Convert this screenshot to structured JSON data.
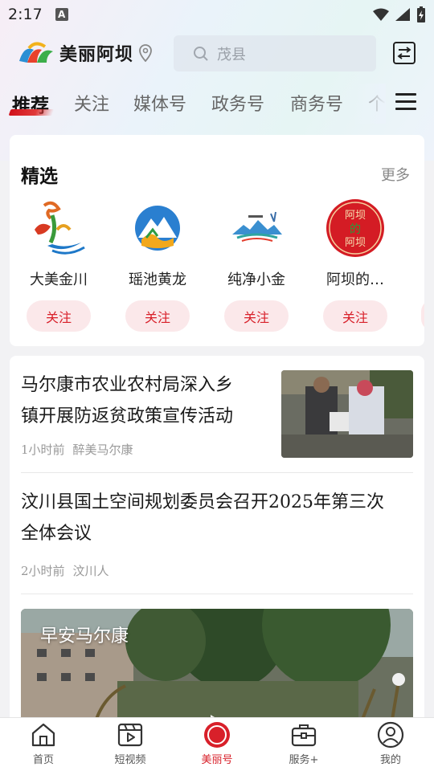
{
  "status_bar": {
    "time": "2:17",
    "notification_icon": "A"
  },
  "header": {
    "logo_text": "美丽阿坝",
    "search_placeholder": "茂县",
    "icons": [
      "logo-icon",
      "location-pin-icon",
      "search-icon",
      "menu-square-icon"
    ]
  },
  "tabs": [
    {
      "label": "推荐",
      "active": true
    },
    {
      "label": "关注"
    },
    {
      "label": "媒体号"
    },
    {
      "label": "政务号"
    },
    {
      "label": "商务号"
    },
    {
      "label": "个人"
    }
  ],
  "featured": {
    "title": "精选",
    "more_label": "更多",
    "accounts": [
      {
        "name": "大美金川",
        "follow_label": "关注"
      },
      {
        "name": "瑶池黄龙",
        "follow_label": "关注"
      },
      {
        "name": "纯净小金",
        "follow_label": "关注"
      },
      {
        "name": "阿坝的…",
        "follow_label": "关注",
        "logo_text": [
          "阿坝",
          "的",
          "阿坝"
        ]
      }
    ]
  },
  "news": [
    {
      "title_lines": [
        "马尔康市农业农村局深入乡",
        "镇开展防返贫政策宣传活动"
      ],
      "time": "1小时前",
      "source": "醉美马尔康"
    },
    {
      "title_lines": [
        "汶川县国土空间规划委员会召开2025年第三次",
        "全体会议"
      ],
      "time": "2小时前",
      "source": "汶川人"
    },
    {
      "title": "早安马尔康",
      "type": "video"
    }
  ],
  "bottom_nav": [
    {
      "label": "首页",
      "icon": "home-icon"
    },
    {
      "label": "短视频",
      "icon": "short-video-icon"
    },
    {
      "label": "美丽号",
      "icon": "meili-icon",
      "active": true
    },
    {
      "label": "服务+",
      "icon": "service-briefcase-icon"
    },
    {
      "label": "我的",
      "icon": "profile-icon"
    }
  ],
  "colors": {
    "accent": "#d8202a",
    "follow_bg": "#fbe8ea"
  }
}
